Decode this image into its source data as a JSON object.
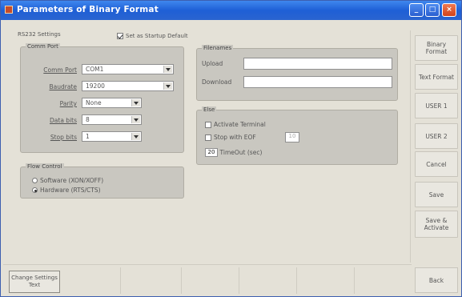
{
  "window": {
    "title": "Parameters of Binary Format"
  },
  "titlebar_buttons": {
    "minimize": "_",
    "maximize": "□",
    "close": "×"
  },
  "header": {
    "rs232_label": "RS232 Settings",
    "startup_default_label": "Set as Startup Default",
    "startup_default_checked": true
  },
  "comm_port": {
    "title": "Comm Port",
    "fields": [
      {
        "label": "Comm Port",
        "value": "COM1"
      },
      {
        "label": "Baudrate",
        "value": "19200"
      },
      {
        "label": "Parity",
        "value": "None"
      },
      {
        "label": "Data bits",
        "value": "8"
      },
      {
        "label": "Stop bits",
        "value": "1"
      }
    ]
  },
  "flow_control": {
    "title": "Flow Control",
    "options": [
      {
        "label": "Software (XON/XOFF)",
        "selected": false
      },
      {
        "label": "Hardware (RTS/CTS)",
        "selected": true
      }
    ]
  },
  "filenames": {
    "title": "Filenames",
    "upload_label": "Upload",
    "upload_value": "",
    "download_label": "Download",
    "download_value": ""
  },
  "else": {
    "title": "Else",
    "activate_terminal": {
      "label": "Activate Terminal",
      "checked": false
    },
    "stop_with_eof": {
      "label": "Stop with EOF",
      "checked": false,
      "value": "10"
    },
    "timeout": {
      "label": "TimeOut (sec)",
      "value": "20"
    }
  },
  "sidebar_buttons": [
    {
      "label": "Binary Format"
    },
    {
      "label": "Text Format"
    },
    {
      "label": "USER 1"
    },
    {
      "label": "USER 2"
    },
    {
      "label": "Cancel"
    },
    {
      "label": "Save"
    },
    {
      "label": "Save & Activate"
    }
  ],
  "bottom": {
    "change_button": "Change Settings Text",
    "back_button": "Back"
  },
  "colors": {
    "titlebar": "#2a64d0",
    "window_bg": "#e4e1d7",
    "group_bg": "#c9c7c0"
  }
}
